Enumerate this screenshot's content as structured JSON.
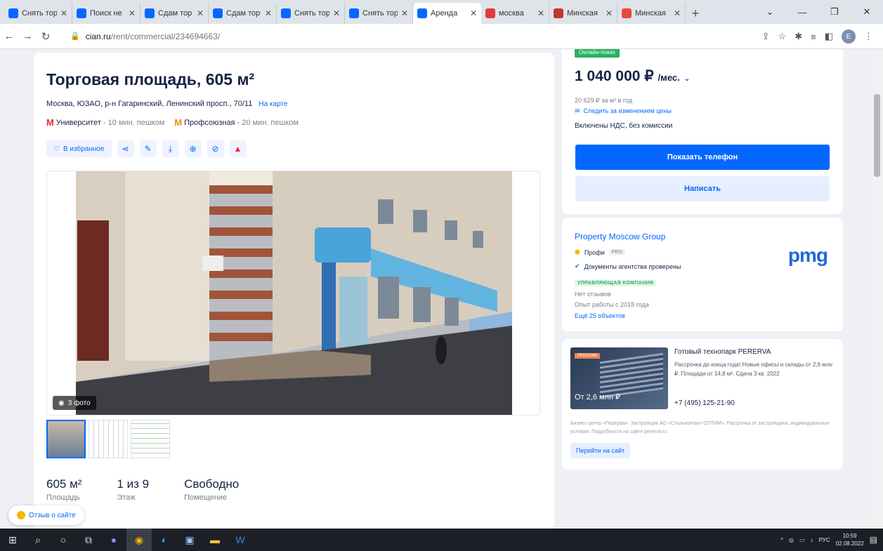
{
  "browser": {
    "tabs": [
      {
        "label": "Снять тор",
        "icon": "cian-logo-icon",
        "color": "#0468ff",
        "active": false
      },
      {
        "label": "Поиск не",
        "icon": "cian-logo-icon",
        "color": "#0468ff",
        "active": false
      },
      {
        "label": "Сдам тор",
        "icon": "cian-logo-icon",
        "color": "#0468ff",
        "active": false
      },
      {
        "label": "Сдам тор",
        "icon": "cian-logo-icon",
        "color": "#0468ff",
        "active": false
      },
      {
        "label": "Снять тор",
        "icon": "cian-logo-icon",
        "color": "#0468ff",
        "active": false
      },
      {
        "label": "Снять тор",
        "icon": "cian-logo-icon",
        "color": "#0468ff",
        "active": false
      },
      {
        "label": "Аренда",
        "icon": "cian-logo-icon",
        "color": "#0468ff",
        "active": true
      },
      {
        "label": "москва",
        "icon": "opera-logo-icon",
        "color": "#e33a3a",
        "active": false
      },
      {
        "label": "Минская",
        "icon": "logo-icon",
        "color": "#c0392b",
        "active": false
      },
      {
        "label": "Минская",
        "icon": "map-pin-icon",
        "color": "#e64a3c",
        "active": false
      }
    ],
    "url_domain": "cian.ru",
    "url_path": "/rent/commercial/234694663/",
    "profile_letter": "E"
  },
  "listing": {
    "title": "Торговая площадь, 605 м²",
    "address": "Москва, ЮЗАО, р-н Гагаринский, Ленинский просп., 70/11",
    "on_map": "На карте",
    "metro": [
      {
        "name": "Университет",
        "walk": "- 10 мин. пешком",
        "color": "#e4292f"
      },
      {
        "name": "Профсоюзная",
        "walk": "- 20 мин. пешком",
        "color": "#f28b00"
      }
    ],
    "favorite": "В избранное",
    "photo_count": "3 фото",
    "facts": [
      {
        "value": "605 м²",
        "label": "Площадь"
      },
      {
        "value": "1 из 9",
        "label": "Этаж"
      },
      {
        "value": "Свободно",
        "label": "Помещение"
      }
    ]
  },
  "price_card": {
    "online_badge": "Онлайн-показ",
    "price": "1 040 000 ₽",
    "per": "/мес.",
    "per_meter": "20 629 ₽ за м² в год",
    "track": "Следить за изменением цены",
    "vat": "Включены НДС, без комиссии",
    "show_phone": "Показать телефон",
    "write": "Написать"
  },
  "agent": {
    "name": "Property Moscow Group",
    "level": "Профи",
    "pro": "PRO",
    "verified": "Документы агентства проверены",
    "company_type": "УПРАВЛЯЮЩАЯ КОМПАНИЯ",
    "reviews": "Нет отзывов",
    "experience": "Опыт работы с 2018 года",
    "more": "Ещё 25 объектов",
    "logo": "pmg"
  },
  "ad": {
    "badge": "РЕКЛАМА",
    "price": "От 2,6 млн ₽",
    "title": "Готовый технопарк PERERVA",
    "text": "Рассрочка до конца года! Новые офисы и склады от 2,6 млн ₽. Площади от 14,8 м². Сдача 3 кв. 2022",
    "phone": "+7 (495) 125-21-90",
    "legal": "Бизнес-центр «Перерва». Застройщик АО «Стальконтакт-ОПТИМ». Рассрочка от застройщика, индивидуальные условия. Подробности на сайте pererva.ru",
    "button": "Перейти на сайт"
  },
  "feedback": "Отзыв о сайте",
  "taskbar": {
    "lang": "РУС",
    "time": "10:59",
    "date": "02.08.2022"
  }
}
